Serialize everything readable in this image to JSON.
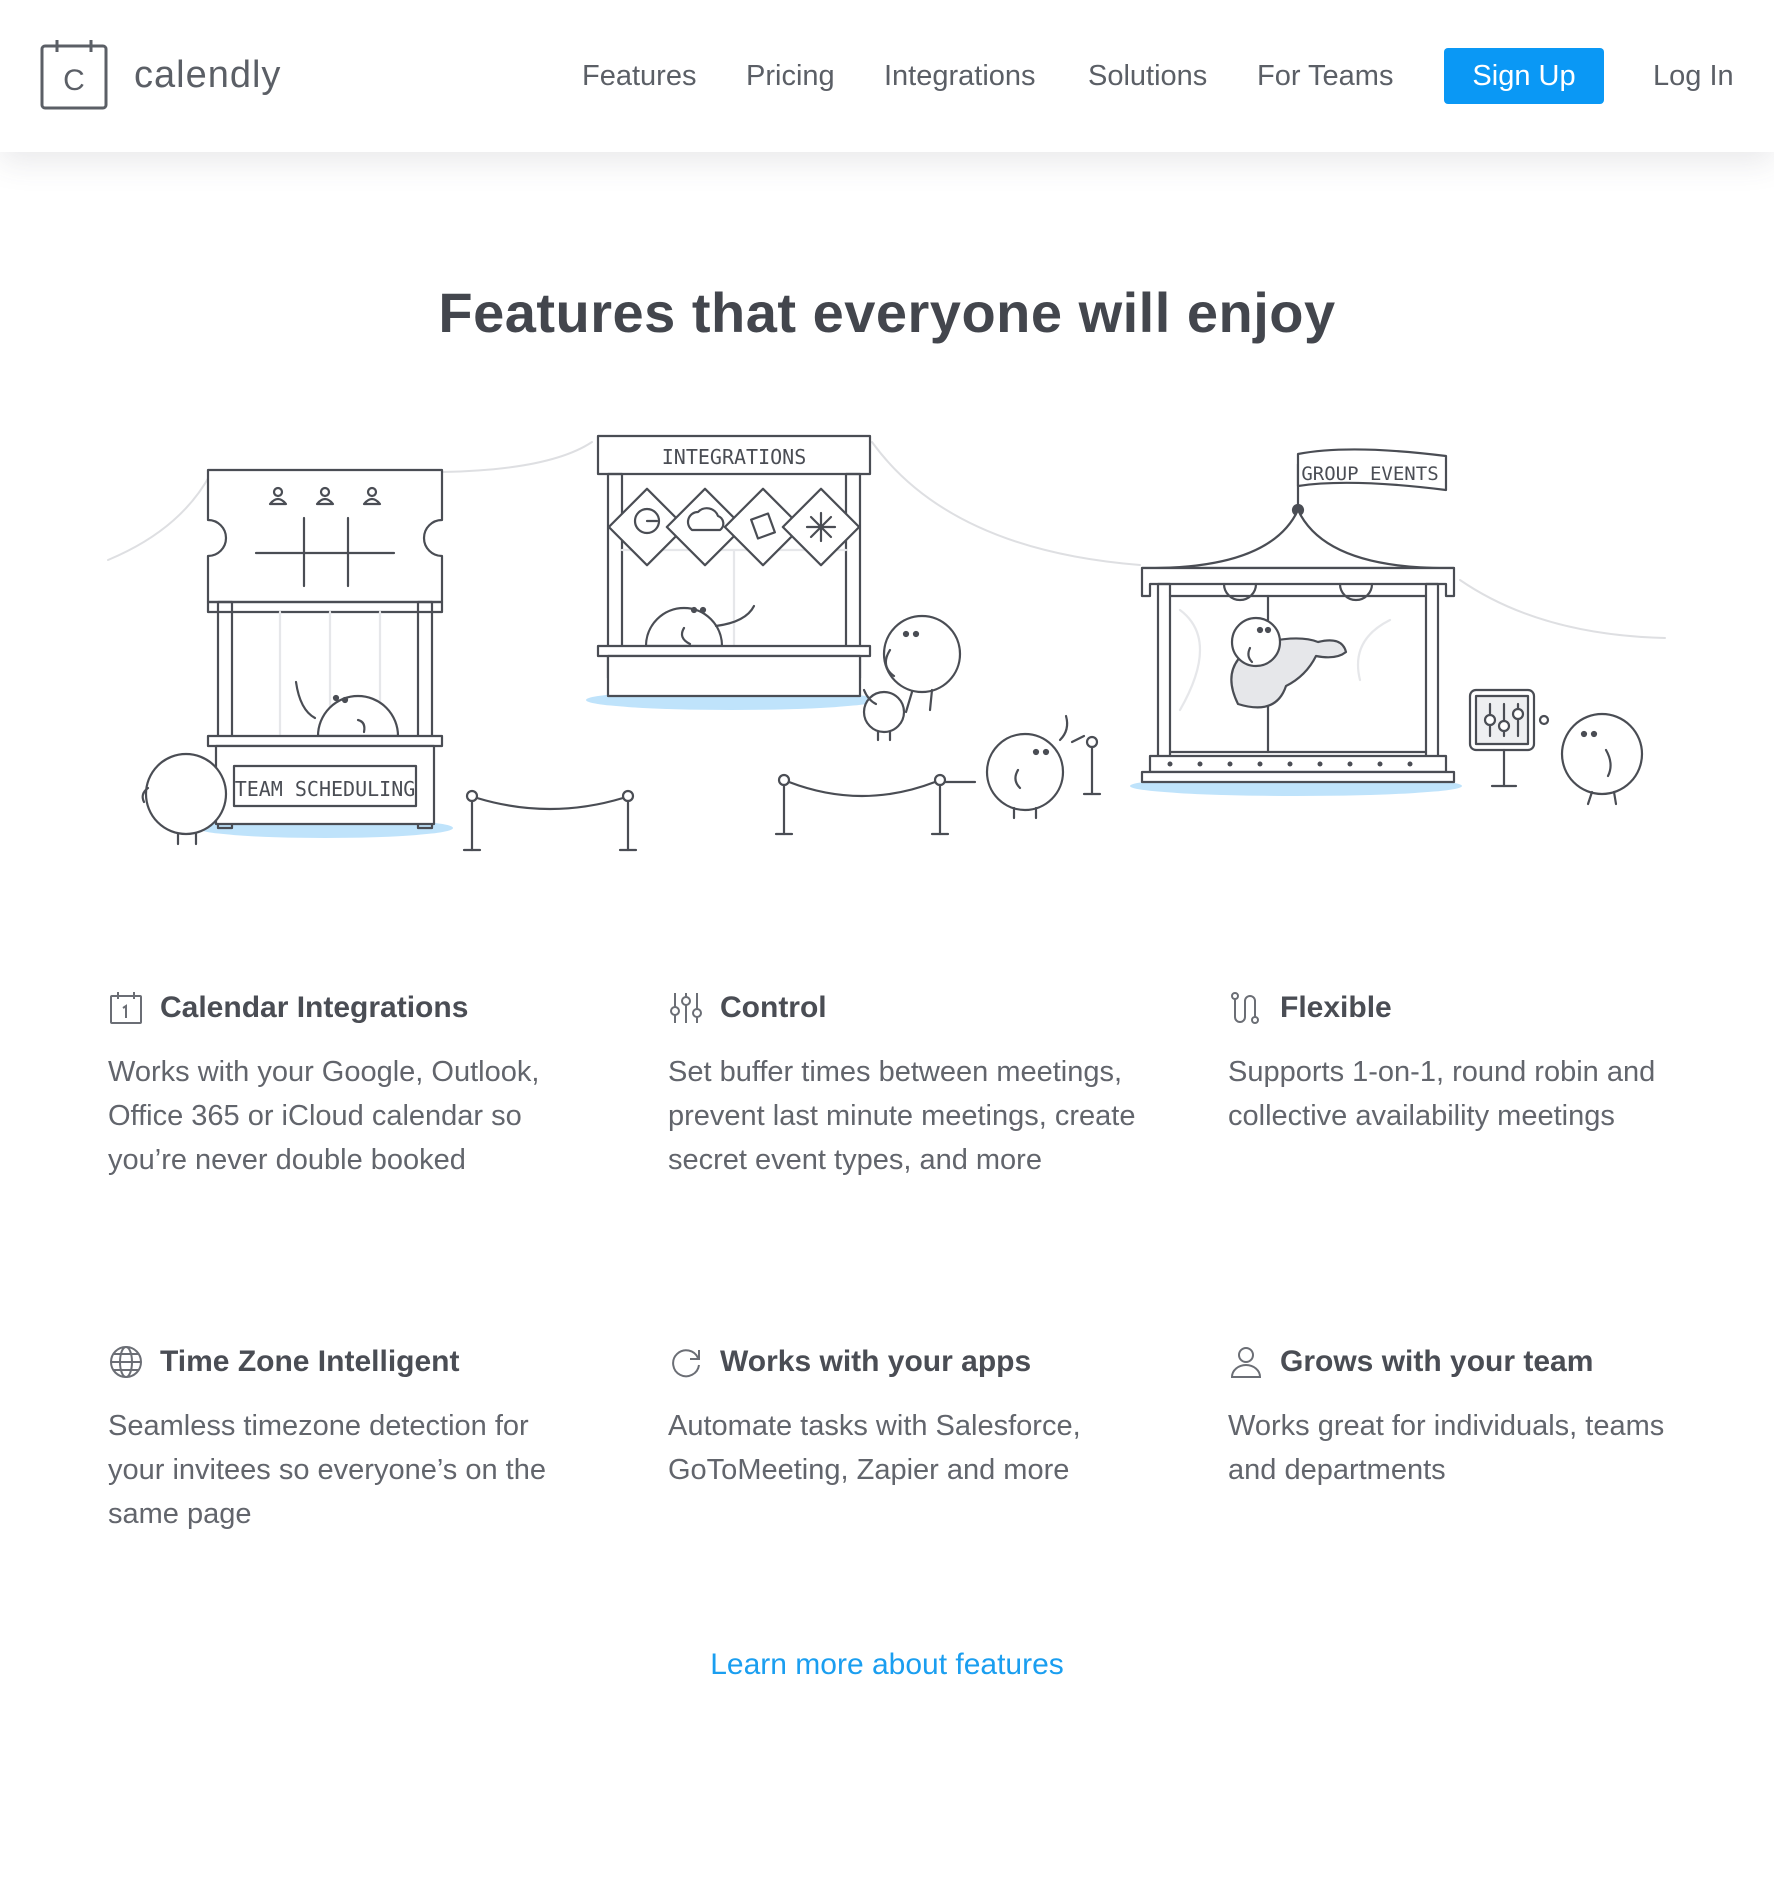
{
  "brand": {
    "name": "calendly",
    "logo_letter": "C",
    "accent": "#0a98f5"
  },
  "nav": {
    "links": [
      "Features",
      "Pricing",
      "Integrations",
      "Solutions",
      "For Teams"
    ],
    "signup_label": "Sign Up",
    "login_label": "Log In"
  },
  "hero": {
    "title": "Features that everyone will enjoy"
  },
  "illustration": {
    "labels": {
      "team": "TEAM SCHEDULING",
      "integrations": "INTEGRATIONS",
      "group": "GROUP EVENTS"
    }
  },
  "features": [
    {
      "icon": "calendar-icon",
      "title": "Calendar Integrations",
      "desc": "Works with your Google, Outlook, Office 365 or iCloud calendar so you’re never double booked"
    },
    {
      "icon": "sliders-icon",
      "title": "Control",
      "desc": "Set buffer times between meetings, prevent last minute meetings, create secret event types, and more"
    },
    {
      "icon": "flexible-icon",
      "title": "Flexible",
      "desc": "Supports 1-on-1, round robin and collective availability meetings"
    },
    {
      "icon": "globe-icon",
      "title": "Time Zone Intelligent",
      "desc": "Seamless timezone detection for your invitees so everyone’s on the same page"
    },
    {
      "icon": "sync-icon",
      "title": "Works with your apps",
      "desc": "Automate tasks with Salesforce, GoToMeeting, Zapier and more"
    },
    {
      "icon": "user-icon",
      "title": "Grows with your team",
      "desc": "Works great for individuals, teams and departments"
    }
  ],
  "learn_more": "Learn more about features"
}
